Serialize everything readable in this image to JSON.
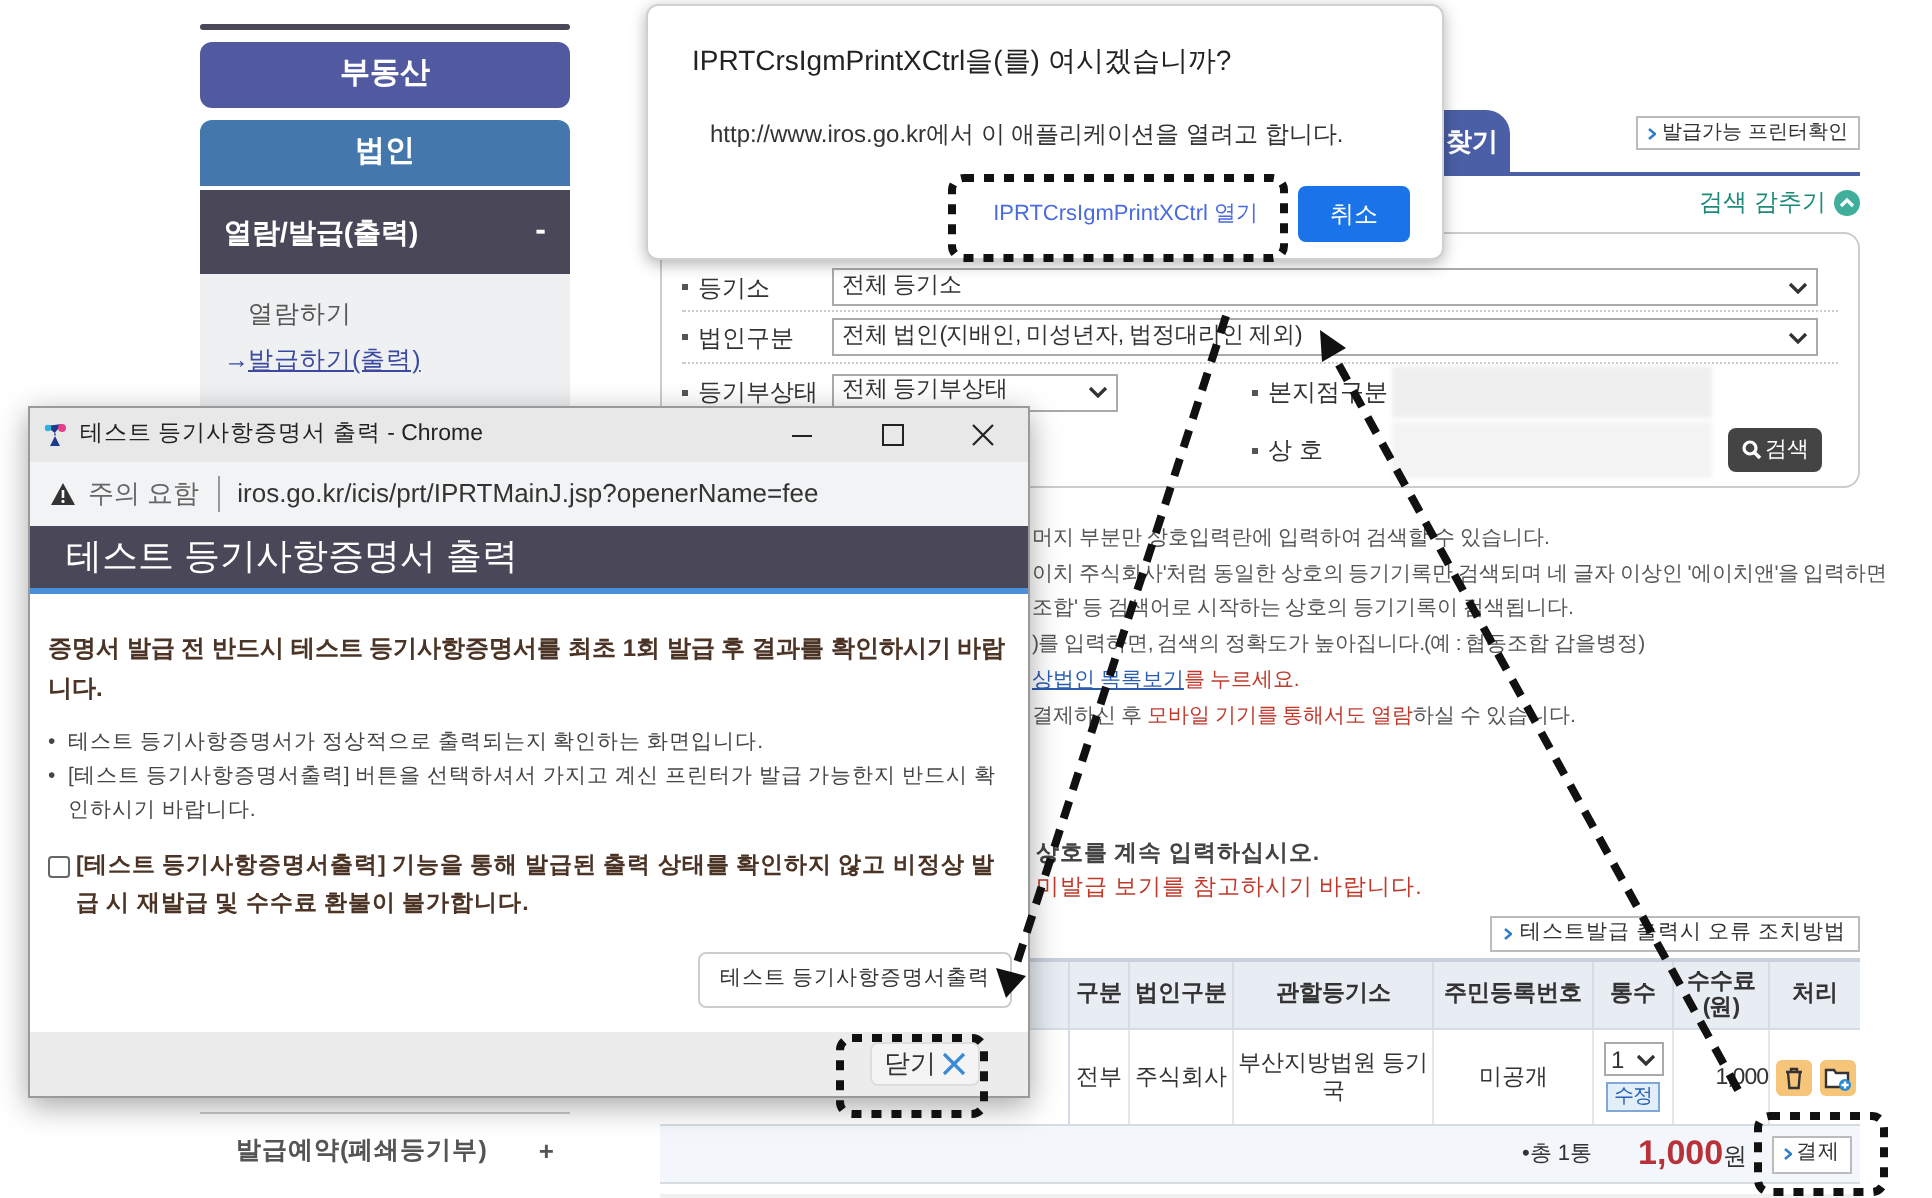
{
  "sidebar": {
    "items": [
      {
        "label": "부동산",
        "selected": false
      },
      {
        "label": "법인",
        "selected": true
      }
    ],
    "section": {
      "label": "열람/발급(출력)",
      "toggle": "-",
      "links": [
        {
          "label": "열람하기",
          "selected": false
        },
        {
          "label": "발급하기(출력)",
          "selected": true,
          "marker": "→"
        }
      ]
    },
    "bottom_item": {
      "label": "발급예약(폐쇄등기부)",
      "toggle": "+"
    }
  },
  "main": {
    "tab": {
      "label": "찾기",
      "selected": true
    },
    "printer_button": "발급가능 프린터확인",
    "search_toggle": "검색 감추기",
    "search_form": {
      "registry_office": {
        "label": "등기소",
        "value": "전체 등기소"
      },
      "corp_type": {
        "label": "법인구분",
        "value": "전체 법인(지배인, 미성년자, 법정대리인 제외)"
      },
      "status": {
        "label": "등기부상태",
        "value": "전체 등기부상태"
      },
      "branch": {
        "label": "본지점구분"
      },
      "name": {
        "label": "상 호"
      },
      "search_button": "검색"
    },
    "notes": [
      [
        {
          "kind": "plain",
          "text": "머지 부분만 상호입력란에 입력하여 검색할 수 있습니다."
        }
      ],
      [
        {
          "kind": "plain",
          "text": "이치 주식회사'처럼 동일한 상호의 등기기록만 검색되며 네 글자 이상인 '에이치앤'을 입력하면"
        }
      ],
      [
        {
          "kind": "plain",
          "text": "조합' 등 검색어로 시작하는 상호의 등기기록이 검색됩니다."
        }
      ],
      [
        {
          "kind": "plain",
          "text": ")를 입력하면, 검색의 정확도가 높아집니다.(예 : 협동조합 갑을병정)"
        }
      ],
      [
        {
          "kind": "link",
          "text": "상법인 목록보기"
        },
        {
          "kind": "red",
          "text": "를 누르세요."
        }
      ],
      [
        {
          "kind": "plain",
          "text": "결제하신 후 "
        },
        {
          "kind": "red",
          "text": "모바일 기기를 통해서도 열람"
        },
        {
          "kind": "plain",
          "text": "하실 수 있습니다."
        }
      ]
    ],
    "notes_bottom": [
      {
        "kind": "bold",
        "text": "상호를 계속 입력하십시오."
      },
      {
        "kind": "red",
        "text": "미발급 보기를 참고하시기 바랍니다."
      }
    ],
    "error_help_button": "테스트발급 출력시 오류 조치방법",
    "table": {
      "columns": [
        "구분",
        "법인구분",
        "관할등기소",
        "주민등록번호",
        "통수",
        "수수료 (원)",
        "처리"
      ],
      "rows": [
        [
          {
            "kind": "text",
            "text": "전부"
          },
          {
            "kind": "text",
            "text": "주식회사"
          },
          {
            "kind": "text",
            "text": "부산지방법원 등기국"
          },
          {
            "kind": "text",
            "text": "미공개"
          },
          {
            "kind": "copies",
            "value": "1",
            "button": "수정"
          },
          {
            "kind": "fee",
            "text": "1,000"
          },
          {
            "kind": "actions"
          }
        ]
      ]
    },
    "summary": {
      "count": "•총 1통",
      "total": "1,000",
      "unit": "원",
      "pay_button": "결제"
    }
  },
  "permission_dialog": {
    "title": "IPRTCrsIgmPrintXCtrl을(를) 여시겠습니까?",
    "message": "http://www.iros.go.kr에서 이 애플리케이션을 열려고 합니다.",
    "open_button": "IPRTCrsIgmPrintXCtrl 열기",
    "cancel_button": "취소"
  },
  "popup_window": {
    "title": "테스트 등기사항증명서 출력 - Chrome",
    "warning": "주의 요함",
    "url": "iros.go.kr/icis/prt/IPRTMainJ.jsp?openerName=fee",
    "header": "테스트 등기사항증명서 출력",
    "notice": "증명서 발급 전 반드시 테스트 등기사항증명서를 최초 1회 발급 후 결과를 확인하시기 바랍니다.",
    "bullets": [
      {
        "bullet": "•",
        "text": "테스트 등기사항증명서가 정상적으로 출력되는지 확인하는 화면입니다."
      },
      {
        "bullet": "•",
        "text": "[테스트 등기사항증명서출력] 버튼을 선택하셔서 가지고 계신 프린터가 발급 가능한지 반드시 확인하시기 바랍니다."
      }
    ],
    "agreement": {
      "checked": false,
      "label": "[테스트 등기사항증명서출력] 기능을 통해 발급된 출력 상태를 확인하지 않고 비정상 발급 시 재발급 및 수수료 환불이 불가합니다."
    },
    "test_print_button": "테스트 등기사항증명서출력",
    "close_button": "닫기"
  }
}
